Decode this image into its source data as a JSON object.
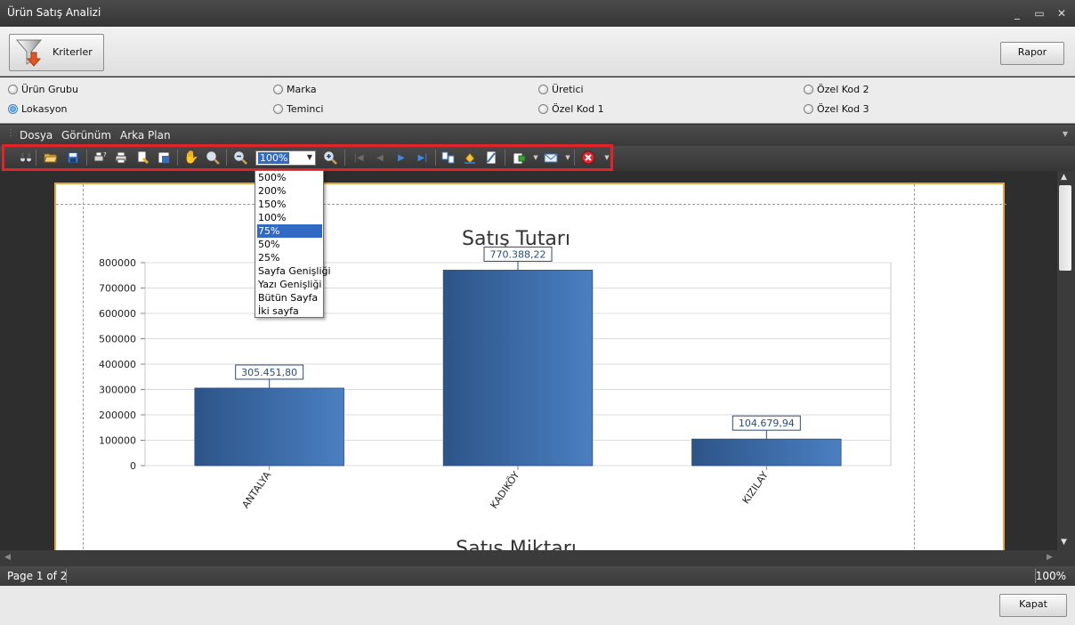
{
  "window": {
    "title": "Ürün Satış Analizi",
    "controls": [
      "_",
      "▭",
      "✕"
    ]
  },
  "top_panel": {
    "criteria_button": "Kriterler",
    "report_button": "Rapor"
  },
  "groupings": [
    {
      "label": "Ürün Grubu",
      "selected": false
    },
    {
      "label": "Marka",
      "selected": false
    },
    {
      "label": "Üretici",
      "selected": false
    },
    {
      "label": "Özel Kod 2",
      "selected": false
    },
    {
      "label": "Lokasyon",
      "selected": true
    },
    {
      "label": "Temin­ci",
      "selected": false
    },
    {
      "label": "Özel Kod 1",
      "selected": false
    },
    {
      "label": "Özel Kod 3",
      "selected": false
    }
  ],
  "menu": [
    "Dosya",
    "Görünüm",
    "Arka Plan"
  ],
  "toolbar": {
    "zoom_value": "100%",
    "zoom_options": [
      "500%",
      "200%",
      "150%",
      "100%",
      "75%",
      "50%",
      "25%",
      "Sayfa Genişliği",
      "Yazı Genişliği",
      "Bütün Sayfa",
      "İki sayfa"
    ],
    "highlighted_option": "75%",
    "icons": [
      "binoculars-icon",
      "open-icon",
      "save-icon",
      "print-setup-icon",
      "print-icon",
      "quick-print-icon",
      "page-setup-icon",
      "hand-tool-icon",
      "magnifier-icon",
      "zoom-out-icon",
      "zoom-in-icon",
      "first-page-icon",
      "prev-page-icon",
      "next-page-icon",
      "last-page-icon",
      "multi-page-icon",
      "background-color-icon",
      "watermark-icon",
      "export-icon",
      "send-email-icon",
      "close-preview-icon"
    ]
  },
  "status": {
    "page": "Page 1 of 2",
    "zoom": "100%"
  },
  "bottom": {
    "close_button": "Kapat"
  },
  "chart_data": [
    {
      "type": "bar",
      "title": "Satış Tutarı",
      "categories": [
        "ANTALYA",
        "KADIKÖY",
        "KIZILAY"
      ],
      "values": [
        305451.8,
        770388.22,
        104679.94
      ],
      "value_labels": [
        "305.451,80",
        "770.388,22",
        "104.679,94"
      ],
      "yticks": [
        "0",
        "100000",
        "200000",
        "300000",
        "400000",
        "500000",
        "600000",
        "700000",
        "800000"
      ],
      "ylim": [
        0,
        800000
      ],
      "grid": true,
      "bar_color_start": "#2d5488",
      "bar_color_end": "#4a7fc1"
    },
    {
      "type": "bar",
      "title": "Satış Miktarı"
    }
  ]
}
